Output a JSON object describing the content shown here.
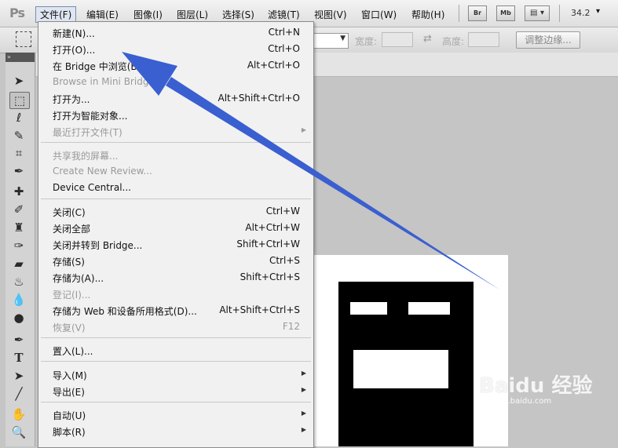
{
  "app": {
    "logo": "Ps"
  },
  "menubar": {
    "items": [
      {
        "label": "文件(F)"
      },
      {
        "label": "编辑(E)"
      },
      {
        "label": "图像(I)"
      },
      {
        "label": "图层(L)"
      },
      {
        "label": "选择(S)"
      },
      {
        "label": "滤镜(T)"
      },
      {
        "label": "视图(V)"
      },
      {
        "label": "窗口(W)"
      },
      {
        "label": "帮助(H)"
      }
    ],
    "bridge_label": "Br",
    "mini_bridge_label": "Mb",
    "zoom": "34.2"
  },
  "options_bar": {
    "width_label": "宽度:",
    "height_label": "高度:",
    "refine_edge_label": "调整边缘..."
  },
  "file_menu": {
    "items": [
      {
        "label": "新建(N)...",
        "shortcut": "Ctrl+N"
      },
      {
        "label": "打开(O)...",
        "shortcut": "Ctrl+O"
      },
      {
        "label": "在 Bridge 中浏览(B)...",
        "shortcut": "Alt+Ctrl+O"
      },
      {
        "label": "Browse in Mini Bridge...",
        "shortcut": ""
      },
      {
        "label": "打开为...",
        "shortcut": "Alt+Shift+Ctrl+O"
      },
      {
        "label": "打开为智能对象...",
        "shortcut": ""
      },
      {
        "label": "最近打开文件(T)",
        "shortcut": ""
      },
      {
        "label": "共享我的屏幕...",
        "shortcut": ""
      },
      {
        "label": "Create New Review...",
        "shortcut": ""
      },
      {
        "label": "Device Central...",
        "shortcut": ""
      },
      {
        "label": "关闭(C)",
        "shortcut": "Ctrl+W"
      },
      {
        "label": "关闭全部",
        "shortcut": "Alt+Ctrl+W"
      },
      {
        "label": "关闭并转到 Bridge...",
        "shortcut": "Shift+Ctrl+W"
      },
      {
        "label": "存储(S)",
        "shortcut": "Ctrl+S"
      },
      {
        "label": "存储为(A)...",
        "shortcut": "Shift+Ctrl+S"
      },
      {
        "label": "登记(I)...",
        "shortcut": ""
      },
      {
        "label": "存储为 Web 和设备所用格式(D)...",
        "shortcut": "Alt+Shift+Ctrl+S"
      },
      {
        "label": "恢复(V)",
        "shortcut": "F12"
      },
      {
        "label": "置入(L)...",
        "shortcut": ""
      },
      {
        "label": "导入(M)",
        "shortcut": ""
      },
      {
        "label": "导出(E)",
        "shortcut": ""
      },
      {
        "label": "自动(U)",
        "shortcut": ""
      },
      {
        "label": "脚本(R)",
        "shortcut": ""
      }
    ]
  },
  "toolbox": {
    "tools": [
      "move-tool",
      "marquee-tool",
      "lasso-tool",
      "quick-selection-tool",
      "crop-tool",
      "eyedropper-tool",
      "healing-brush-tool",
      "brush-tool",
      "clone-stamp-tool",
      "history-brush-tool",
      "eraser-tool",
      "paint-bucket-tool",
      "blur-tool",
      "dodge-tool",
      "pen-tool",
      "type-tool",
      "path-selection-tool",
      "line-tool",
      "hand-tool",
      "zoom-tool"
    ]
  },
  "watermark": {
    "logo": "Baidu 经验",
    "url": "jingyan.baidu.com"
  },
  "colors": {
    "arrow": "#3a5fd0",
    "menubar": "#e6e6e6",
    "canvas_bg": "#c5c5c5"
  }
}
